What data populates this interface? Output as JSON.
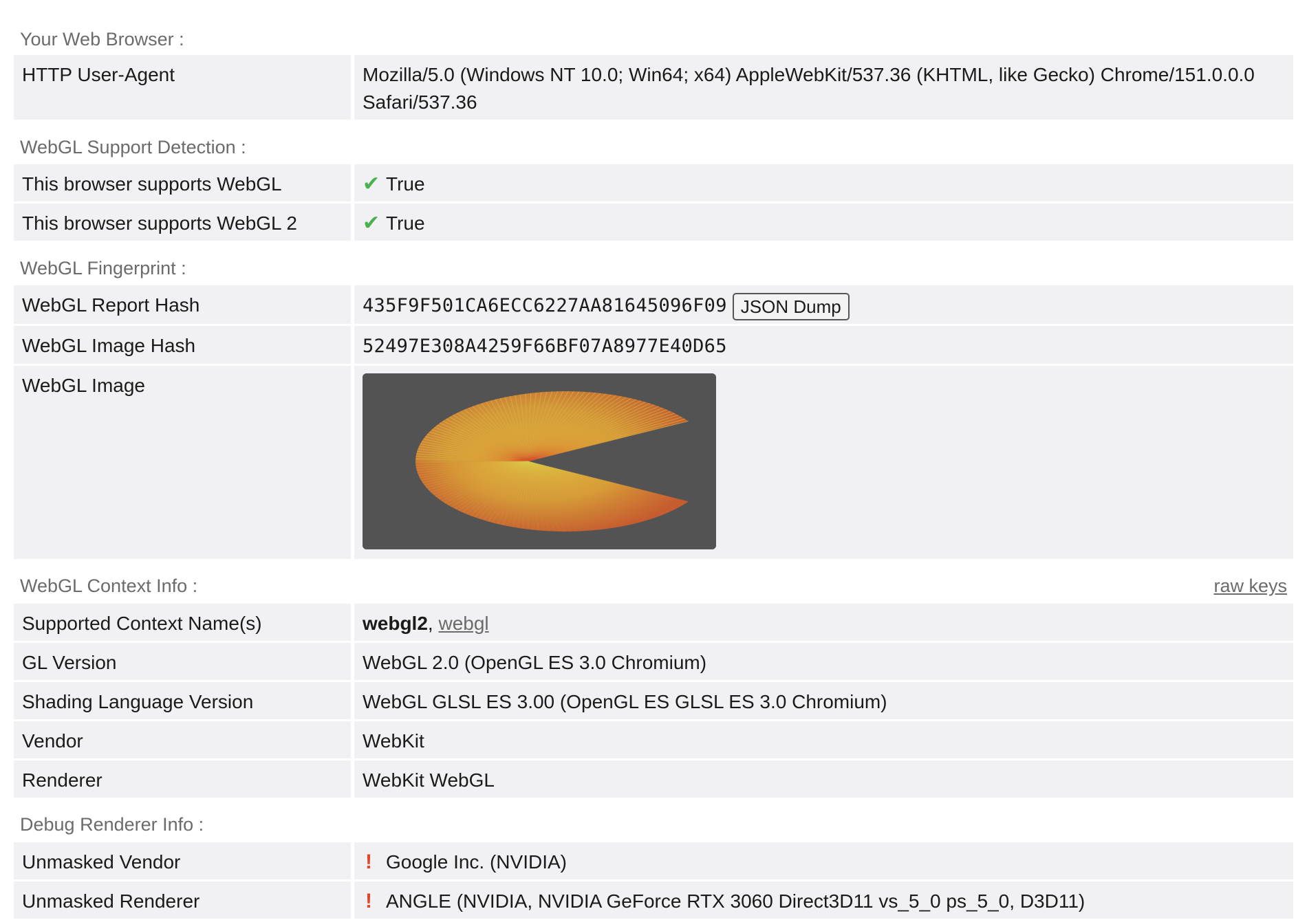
{
  "browser": {
    "title": "Your Web Browser :",
    "ua_label": "HTTP User-Agent",
    "ua_value": "Mozilla/5.0 (Windows NT 10.0; Win64; x64) AppleWebKit/537.36 (KHTML, like Gecko) Chrome/151.0.0.0 Safari/537.36"
  },
  "support": {
    "title": "WebGL Support Detection :",
    "rows": [
      {
        "label": "This browser supports WebGL",
        "value": "True"
      },
      {
        "label": "This browser supports WebGL 2",
        "value": "True"
      }
    ],
    "check_color": "#4caf50"
  },
  "fingerprint": {
    "title": "WebGL Fingerprint :",
    "report_hash_label": "WebGL Report Hash",
    "report_hash_value": "435F9F501CA6ECC6227AA81645096F09",
    "json_dump_label": "JSON Dump",
    "image_hash_label": "WebGL Image Hash",
    "image_hash_value": "52497E308A4259F66BF07A8977E40D65",
    "image_label": "WebGL Image",
    "image_bg_color": "#535353"
  },
  "context": {
    "title": "WebGL Context Info :",
    "raw_keys_label": "raw keys",
    "names_label": "Supported Context Name(s)",
    "name_primary": "webgl2",
    "name_sep": ", ",
    "name_secondary": "webgl",
    "gl_version_label": "GL Version",
    "gl_version_value": "WebGL 2.0 (OpenGL ES 3.0 Chromium)",
    "shading_label": "Shading Language Version",
    "shading_value": "WebGL GLSL ES 3.00 (OpenGL ES GLSL ES 3.0 Chromium)",
    "vendor_label": "Vendor",
    "vendor_value": "WebKit",
    "renderer_label": "Renderer",
    "renderer_value": "WebKit WebGL"
  },
  "debug": {
    "title": "Debug Renderer Info :",
    "unmasked_vendor_label": "Unmasked Vendor",
    "unmasked_vendor_value": "Google Inc. (NVIDIA)",
    "unmasked_renderer_label": "Unmasked Renderer",
    "unmasked_renderer_value": "ANGLE (NVIDIA, NVIDIA GeForce RTX 3060 Direct3D11 vs_5_0 ps_5_0, D3D11)",
    "warn_color": "#e0472a"
  },
  "icons": {
    "check": "✔",
    "warn": "!"
  }
}
